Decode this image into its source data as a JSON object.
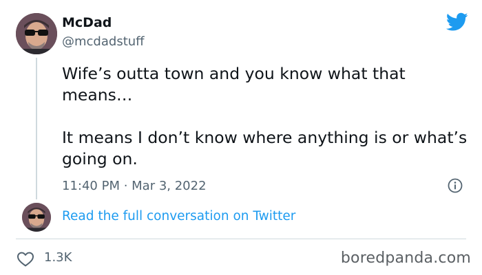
{
  "author": {
    "name": "McDad",
    "handle": "@mcdadstuff"
  },
  "tweet": {
    "paragraphs": [
      "Wife’s outta town and you know what that means…",
      "It means I don’t know where anything is or what’s going on."
    ],
    "timestamp": "11:40 PM · Mar 3, 2022"
  },
  "read_full_conversation": "Read the full conversation on Twitter",
  "likes": {
    "count": "1.3K"
  },
  "watermark": "boredpanda.com",
  "icons": {
    "brand": "twitter-bird-icon",
    "info": "info-icon",
    "like": "heart-icon"
  },
  "colors": {
    "link": "#1d9bf0",
    "brand": "#1d9bf0",
    "secondary_text": "#536471",
    "primary_text": "#0f1419",
    "divider": "#cfd9de"
  }
}
